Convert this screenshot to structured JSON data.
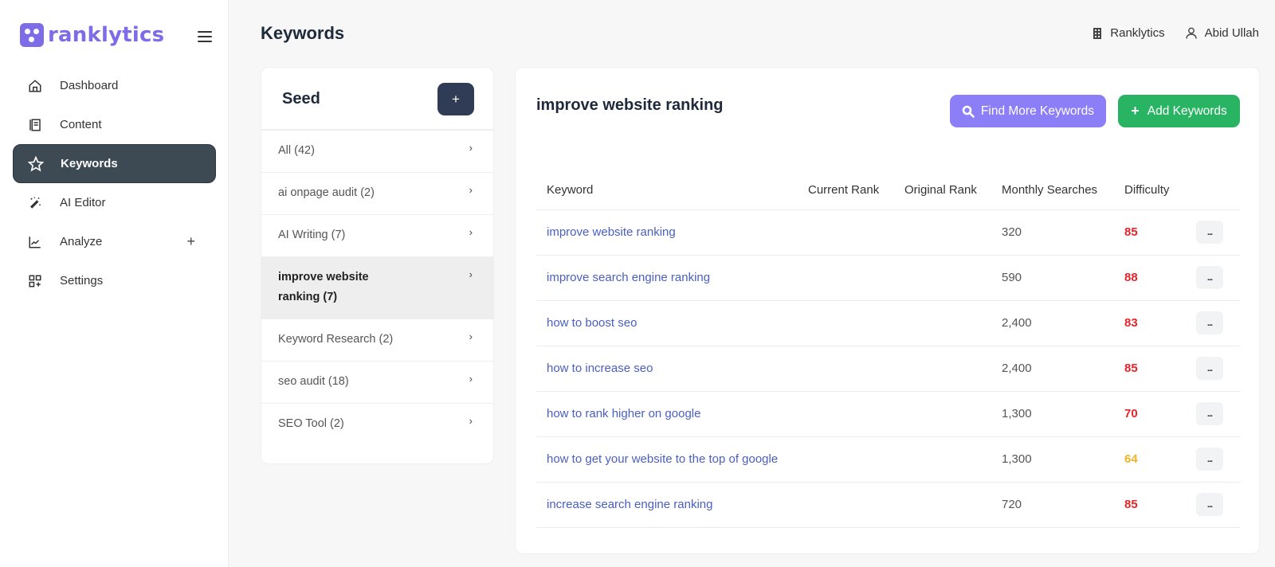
{
  "brand": {
    "name": "ranklytics",
    "color": "#7c6ce8"
  },
  "sidebar": {
    "items": [
      {
        "label": "Dashboard",
        "icon": "home-icon",
        "active": false
      },
      {
        "label": "Content",
        "icon": "document-icon",
        "active": false
      },
      {
        "label": "Keywords",
        "icon": "star-icon",
        "active": true
      },
      {
        "label": "AI Editor",
        "icon": "magic-wand-icon",
        "active": false
      },
      {
        "label": "Analyze",
        "icon": "chart-line-icon",
        "active": false,
        "expand": "+"
      },
      {
        "label": "Settings",
        "icon": "grid-plus-icon",
        "active": false
      }
    ]
  },
  "header": {
    "title": "Keywords",
    "workspace": "Ranklytics",
    "user": "Abid Ullah"
  },
  "seed": {
    "title": "Seed",
    "add_label": "+",
    "items": [
      {
        "label": "All (42)",
        "active": false
      },
      {
        "label": "ai onpage audit (2)",
        "active": false
      },
      {
        "label": "AI Writing (7)",
        "active": false
      },
      {
        "label": "improve website ranking (7)",
        "active": true
      },
      {
        "label": "Keyword Research (2)",
        "active": false
      },
      {
        "label": "seo audit (18)",
        "active": false
      },
      {
        "label": "SEO Tool (2)",
        "active": false
      }
    ]
  },
  "main": {
    "title": "improve website ranking",
    "find_button": "Find More Keywords",
    "add_button": "Add Keywords",
    "colors": {
      "find": "#8b7ef7",
      "add": "#28b463",
      "hard": "#e5242b",
      "medium": "#f0b429"
    },
    "columns": [
      "Keyword",
      "Current Rank",
      "Original Rank",
      "Monthly Searches",
      "Difficulty"
    ],
    "rows": [
      {
        "keyword": "improve website ranking",
        "current_rank": "",
        "original_rank": "",
        "monthly_searches": "320",
        "difficulty": "85",
        "level": "hard"
      },
      {
        "keyword": "improve search engine ranking",
        "current_rank": "",
        "original_rank": "",
        "monthly_searches": "590",
        "difficulty": "88",
        "level": "hard"
      },
      {
        "keyword": "how to boost seo",
        "current_rank": "",
        "original_rank": "",
        "monthly_searches": "2,400",
        "difficulty": "83",
        "level": "hard"
      },
      {
        "keyword": "how to increase seo",
        "current_rank": "",
        "original_rank": "",
        "monthly_searches": "2,400",
        "difficulty": "85",
        "level": "hard"
      },
      {
        "keyword": "how to rank higher on google",
        "current_rank": "",
        "original_rank": "",
        "monthly_searches": "1,300",
        "difficulty": "70",
        "level": "hard"
      },
      {
        "keyword": "how to get your website to the top of google",
        "current_rank": "",
        "original_rank": "",
        "monthly_searches": "1,300",
        "difficulty": "64",
        "level": "medium"
      },
      {
        "keyword": "increase search engine ranking",
        "current_rank": "",
        "original_rank": "",
        "monthly_searches": "720",
        "difficulty": "85",
        "level": "hard"
      }
    ],
    "row_action": "..."
  }
}
